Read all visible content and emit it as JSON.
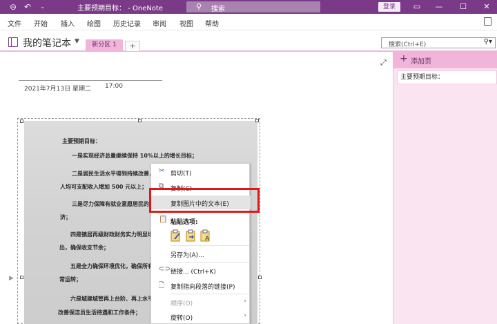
{
  "titlebar": {
    "title": "主要预期目标： - OneNote",
    "search_placeholder": "搜索",
    "login": "登录",
    "back_icon": "back-icon",
    "undo_icon": "undo-icon",
    "qat_icon": "quick-access-icon"
  },
  "menu": [
    "文件",
    "开始",
    "插入",
    "绘图",
    "历史记录",
    "审阅",
    "视图",
    "帮助"
  ],
  "notebook": {
    "name": "我的笔记本",
    "section_tab": "新分区 1",
    "add_section": "+",
    "search_placeholder": "搜索(Ctrl+E)"
  },
  "page": {
    "date": "2021年7月13日 星期二",
    "time": "17:00"
  },
  "right_pane": {
    "add_page": "添加页",
    "pages": [
      "主要预期目标："
    ]
  },
  "doc_lines": [
    "主要预期目标：",
    "一是实现经济总量继续保持 10%以上的增长目标；",
    "二是居民生活水平得到持续改善，",
    "人均可支配收入增加 500 元以上；",
    "三是尽力保障有就业意愿居民的",
    "济；",
    "四是镇居再级财政财务实力明显增",
    "出，确保收支节余；",
    "五是全力确保环境优化，确保所有",
    "常运转；",
    "六是城建城管再上台阶、再上水平",
    "改善保洁员生活待遇和工作条件；"
  ],
  "context_menu": {
    "cut": "剪切(T)",
    "copy": "复制(C)",
    "copy_text": "复制图片中的文本(E)",
    "paste_options": "粘贴选项:",
    "save_as": "另存为(A)...",
    "link": "链接...   (Ctrl+K)",
    "copy_para_link": "复制指向段落的链接(P)",
    "order": "顺序(O)",
    "rotate": "旋转(O)"
  },
  "colors": {
    "accent": "#7b3a87",
    "section": "#f0b5d9",
    "pane": "#fbe4f1",
    "highlight": "#e01818"
  }
}
